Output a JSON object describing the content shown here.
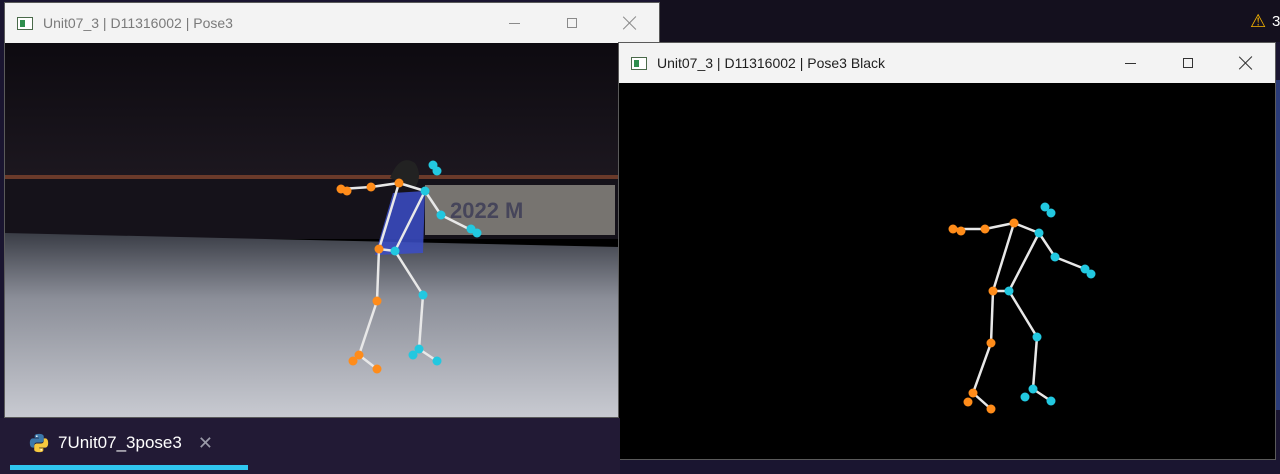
{
  "windows": [
    {
      "title": "Unit07_3 | D11316002 | Pose3",
      "controls": {
        "minimize": "minimize",
        "maximize": "maximize",
        "close": "close"
      }
    },
    {
      "title": "Unit07_3 | D11316002 | Pose3 Black",
      "controls": {
        "minimize": "minimize",
        "maximize": "maximize",
        "close": "close"
      }
    }
  ],
  "video_scene": {
    "banner_text": "2022 M"
  },
  "taskbar": {
    "tab_label": "7Unit07_3pose3",
    "tab_close": "✕"
  },
  "tray": {
    "warning_icon": "⚠",
    "warning_count": "3"
  },
  "colors": {
    "left_joint": "#ff8c1a",
    "right_joint": "#22c8e0",
    "bone": "#e8e8e8",
    "active_tab": "#2fc6ef"
  }
}
